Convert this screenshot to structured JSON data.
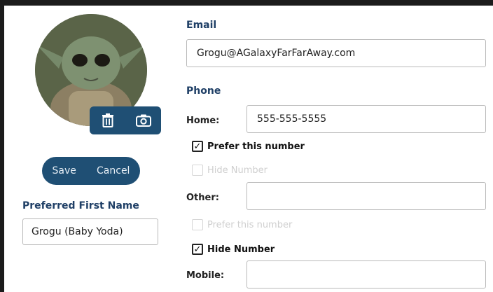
{
  "profile": {
    "save_label": "Save",
    "cancel_label": "Cancel",
    "preferred_first_name": {
      "label": "Preferred First Name",
      "value": "Grogu (Baby Yoda)"
    }
  },
  "contact": {
    "email": {
      "label": "Email",
      "value": "Grogu@AGalaxyFarFarAway.com"
    },
    "phone": {
      "label": "Phone",
      "home": {
        "label": "Home:",
        "value": "555-555-5555",
        "prefer": {
          "label": "Prefer this number",
          "checked": true,
          "disabled": false
        },
        "hide": {
          "label": "Hide Number",
          "checked": false,
          "disabled": true
        }
      },
      "other": {
        "label": "Other:",
        "value": "",
        "prefer": {
          "label": "Prefer this number",
          "checked": false,
          "disabled": true
        },
        "hide": {
          "label": "Hide Number",
          "checked": true,
          "disabled": false
        }
      },
      "mobile": {
        "label": "Mobile:",
        "value": ""
      }
    }
  },
  "icons": {
    "delete": "trash-icon",
    "camera": "camera-icon"
  },
  "colors": {
    "primary": "#1f4f74",
    "heading": "#1f3f66"
  }
}
